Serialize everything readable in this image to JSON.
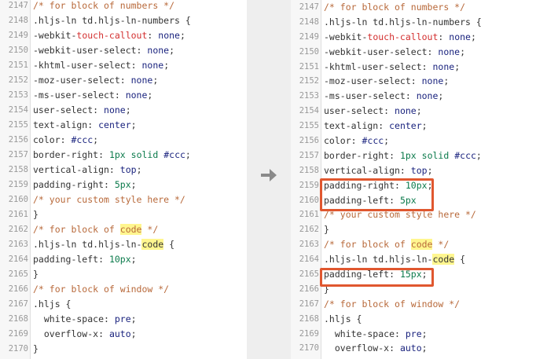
{
  "left": {
    "lines": [
      {
        "num": "2147",
        "code": [
          {
            "t": "/* for block of numbers */",
            "c": "t-comment"
          }
        ]
      },
      {
        "num": "2148",
        "code": [
          {
            "t": ".hljs-ln td.hljs-ln-numbers {",
            "c": ""
          }
        ]
      },
      {
        "num": "2149",
        "code": [
          {
            "t": "-webkit-",
            "c": ""
          },
          {
            "t": "touch-callout",
            "c": "t-red"
          },
          {
            "t": ": ",
            "c": ""
          },
          {
            "t": "none",
            "c": "t-val"
          },
          {
            "t": ";",
            "c": ""
          }
        ]
      },
      {
        "num": "2150",
        "code": [
          {
            "t": "-webkit-user-select: ",
            "c": ""
          },
          {
            "t": "none",
            "c": "t-val"
          },
          {
            "t": ";",
            "c": ""
          }
        ]
      },
      {
        "num": "2151",
        "code": [
          {
            "t": "-khtml-user-select: ",
            "c": ""
          },
          {
            "t": "none",
            "c": "t-val"
          },
          {
            "t": ";",
            "c": ""
          }
        ]
      },
      {
        "num": "2152",
        "code": [
          {
            "t": "-moz-user-select: ",
            "c": ""
          },
          {
            "t": "none",
            "c": "t-val"
          },
          {
            "t": ";",
            "c": ""
          }
        ]
      },
      {
        "num": "2153",
        "code": [
          {
            "t": "-ms-user-select: ",
            "c": ""
          },
          {
            "t": "none",
            "c": "t-val"
          },
          {
            "t": ";",
            "c": ""
          }
        ]
      },
      {
        "num": "2154",
        "code": [
          {
            "t": "user-select: ",
            "c": ""
          },
          {
            "t": "none",
            "c": "t-val"
          },
          {
            "t": ";",
            "c": ""
          }
        ]
      },
      {
        "num": "2155",
        "code": [
          {
            "t": "text-align: ",
            "c": ""
          },
          {
            "t": "center",
            "c": "t-val"
          },
          {
            "t": ";",
            "c": ""
          }
        ]
      },
      {
        "num": "2156",
        "code": [
          {
            "t": "color: ",
            "c": ""
          },
          {
            "t": "#ccc",
            "c": "t-val"
          },
          {
            "t": ";",
            "c": ""
          }
        ]
      },
      {
        "num": "2157",
        "code": [
          {
            "t": "border-right: ",
            "c": ""
          },
          {
            "t": "1px",
            "c": "t-num"
          },
          {
            "t": " ",
            "c": ""
          },
          {
            "t": "solid",
            "c": "t-kw"
          },
          {
            "t": " ",
            "c": ""
          },
          {
            "t": "#ccc",
            "c": "t-val"
          },
          {
            "t": ";",
            "c": ""
          }
        ]
      },
      {
        "num": "2158",
        "code": [
          {
            "t": "vertical-align: ",
            "c": ""
          },
          {
            "t": "top",
            "c": "t-val"
          },
          {
            "t": ";",
            "c": ""
          }
        ]
      },
      {
        "num": "2159",
        "code": [
          {
            "t": "padding-right: ",
            "c": ""
          },
          {
            "t": "5px",
            "c": "t-num"
          },
          {
            "t": ";",
            "c": ""
          }
        ]
      },
      {
        "num": "2160",
        "code": [
          {
            "t": "/* your custom style here */",
            "c": "t-comment"
          }
        ]
      },
      {
        "num": "2161",
        "code": [
          {
            "t": "}",
            "c": ""
          }
        ]
      },
      {
        "num": "2162",
        "code": [
          {
            "t": "/* for block of ",
            "c": "t-comment"
          },
          {
            "t": "code",
            "c": "t-comment hl"
          },
          {
            "t": " */",
            "c": "t-comment"
          }
        ]
      },
      {
        "num": "2163",
        "code": [
          {
            "t": ".hljs-ln td.hljs-ln-",
            "c": ""
          },
          {
            "t": "code",
            "c": "hl"
          },
          {
            "t": " {",
            "c": ""
          }
        ]
      },
      {
        "num": "2164",
        "code": [
          {
            "t": "padding-left: ",
            "c": ""
          },
          {
            "t": "10px",
            "c": "t-num"
          },
          {
            "t": ";",
            "c": ""
          }
        ]
      },
      {
        "num": "2165",
        "code": [
          {
            "t": "}",
            "c": ""
          }
        ]
      },
      {
        "num": "2166",
        "code": [
          {
            "t": "/* for block of window */",
            "c": "t-comment"
          }
        ]
      },
      {
        "num": "2167",
        "code": [
          {
            "t": ".hljs {",
            "c": ""
          }
        ]
      },
      {
        "num": "2168",
        "code": [
          {
            "t": "  white-space: ",
            "c": ""
          },
          {
            "t": "pre",
            "c": "t-val"
          },
          {
            "t": ";",
            "c": ""
          }
        ]
      },
      {
        "num": "2169",
        "code": [
          {
            "t": "  overflow-x: ",
            "c": ""
          },
          {
            "t": "auto",
            "c": "t-val"
          },
          {
            "t": ";",
            "c": ""
          }
        ]
      },
      {
        "num": "2170",
        "code": [
          {
            "t": "}",
            "c": ""
          }
        ]
      }
    ]
  },
  "right": {
    "lines": [
      {
        "num": "2147",
        "code": [
          {
            "t": "/* for block of numbers */",
            "c": "t-comment"
          }
        ]
      },
      {
        "num": "2148",
        "code": [
          {
            "t": ".hljs-ln td.hljs-ln-numbers {",
            "c": ""
          }
        ]
      },
      {
        "num": "2149",
        "code": [
          {
            "t": "-webkit-",
            "c": ""
          },
          {
            "t": "touch-callout",
            "c": "t-red"
          },
          {
            "t": ": ",
            "c": ""
          },
          {
            "t": "none",
            "c": "t-val"
          },
          {
            "t": ";",
            "c": ""
          }
        ]
      },
      {
        "num": "2150",
        "code": [
          {
            "t": "-webkit-user-select: ",
            "c": ""
          },
          {
            "t": "none",
            "c": "t-val"
          },
          {
            "t": ";",
            "c": ""
          }
        ]
      },
      {
        "num": "2151",
        "code": [
          {
            "t": "-khtml-user-select: ",
            "c": ""
          },
          {
            "t": "none",
            "c": "t-val"
          },
          {
            "t": ";",
            "c": ""
          }
        ]
      },
      {
        "num": "2152",
        "code": [
          {
            "t": "-moz-user-select: ",
            "c": ""
          },
          {
            "t": "none",
            "c": "t-val"
          },
          {
            "t": ";",
            "c": ""
          }
        ]
      },
      {
        "num": "2153",
        "code": [
          {
            "t": "-ms-user-select: ",
            "c": ""
          },
          {
            "t": "none",
            "c": "t-val"
          },
          {
            "t": ";",
            "c": ""
          }
        ]
      },
      {
        "num": "2154",
        "code": [
          {
            "t": "user-select: ",
            "c": ""
          },
          {
            "t": "none",
            "c": "t-val"
          },
          {
            "t": ";",
            "c": ""
          }
        ]
      },
      {
        "num": "2155",
        "code": [
          {
            "t": "text-align: ",
            "c": ""
          },
          {
            "t": "center",
            "c": "t-val"
          },
          {
            "t": ";",
            "c": ""
          }
        ]
      },
      {
        "num": "2156",
        "code": [
          {
            "t": "color: ",
            "c": ""
          },
          {
            "t": "#ccc",
            "c": "t-val"
          },
          {
            "t": ";",
            "c": ""
          }
        ]
      },
      {
        "num": "2157",
        "code": [
          {
            "t": "border-right: ",
            "c": ""
          },
          {
            "t": "1px",
            "c": "t-num"
          },
          {
            "t": " ",
            "c": ""
          },
          {
            "t": "solid",
            "c": "t-kw"
          },
          {
            "t": " ",
            "c": ""
          },
          {
            "t": "#ccc",
            "c": "t-val"
          },
          {
            "t": ";",
            "c": ""
          }
        ]
      },
      {
        "num": "2158",
        "code": [
          {
            "t": "vertical-align: ",
            "c": ""
          },
          {
            "t": "top",
            "c": "t-val"
          },
          {
            "t": ";",
            "c": ""
          }
        ]
      },
      {
        "num": "2159",
        "code": [
          {
            "t": "padding-right: ",
            "c": ""
          },
          {
            "t": "10px",
            "c": "t-num"
          },
          {
            "t": ";",
            "c": ""
          }
        ]
      },
      {
        "num": "2160",
        "code": [
          {
            "t": "padding-left: ",
            "c": ""
          },
          {
            "t": "5px",
            "c": "t-num"
          }
        ]
      },
      {
        "num": "2161",
        "code": [
          {
            "t": "/* your custom style here */",
            "c": "t-comment"
          }
        ]
      },
      {
        "num": "2162",
        "code": [
          {
            "t": "}",
            "c": ""
          }
        ]
      },
      {
        "num": "2163",
        "code": [
          {
            "t": "/* for block of ",
            "c": "t-comment"
          },
          {
            "t": "code",
            "c": "t-comment hl"
          },
          {
            "t": " */",
            "c": "t-comment"
          }
        ]
      },
      {
        "num": "2164",
        "code": [
          {
            "t": ".hljs-ln td.hljs-ln-",
            "c": ""
          },
          {
            "t": "code",
            "c": "hl"
          },
          {
            "t": " {",
            "c": ""
          }
        ]
      },
      {
        "num": "2165",
        "code": [
          {
            "t": "padding-left: ",
            "c": ""
          },
          {
            "t": "15px",
            "c": "t-num"
          },
          {
            "t": ";",
            "c": ""
          }
        ]
      },
      {
        "num": "2166",
        "code": [
          {
            "t": "}",
            "c": ""
          }
        ]
      },
      {
        "num": "2167",
        "code": [
          {
            "t": "/* for block of window */",
            "c": "t-comment"
          }
        ]
      },
      {
        "num": "2168",
        "code": [
          {
            "t": ".hljs {",
            "c": ""
          }
        ]
      },
      {
        "num": "2169",
        "code": [
          {
            "t": "  white-space: ",
            "c": ""
          },
          {
            "t": "pre",
            "c": "t-val"
          },
          {
            "t": ";",
            "c": ""
          }
        ]
      },
      {
        "num": "2170",
        "code": [
          {
            "t": "  overflow-x: ",
            "c": ""
          },
          {
            "t": "auto",
            "c": "t-val"
          },
          {
            "t": ";",
            "c": ""
          }
        ]
      }
    ]
  },
  "icons": {
    "arrow": "right-arrow-icon"
  },
  "colors": {
    "highlight_box": "#e0572f",
    "keyword_highlight": "#fff68f",
    "gap_bg": "#eeeeee"
  }
}
